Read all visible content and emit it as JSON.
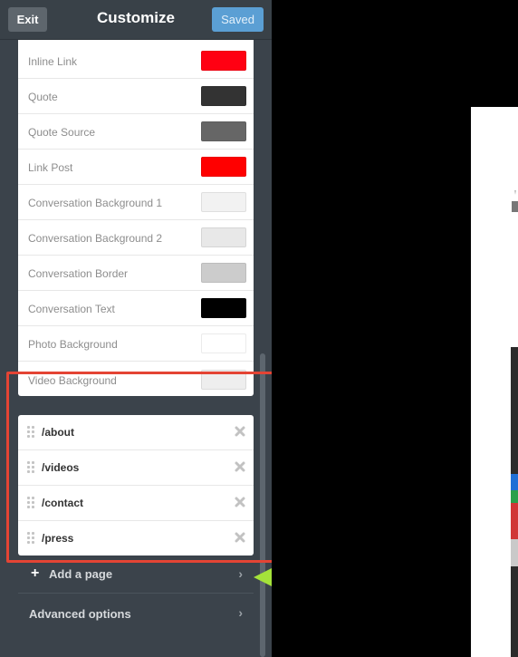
{
  "header": {
    "exit_label": "Exit",
    "title": "Customize",
    "saved_label": "Saved"
  },
  "colors": [
    {
      "label": "Inline Link",
      "value": "#ff0012"
    },
    {
      "label": "Quote",
      "value": "#333333"
    },
    {
      "label": "Quote Source",
      "value": "#666666"
    },
    {
      "label": "Link Post",
      "value": "#ff0000"
    },
    {
      "label": "Conversation Background 1",
      "value": "#f2f2f2"
    },
    {
      "label": "Conversation Background 2",
      "value": "#e8e8e8"
    },
    {
      "label": "Conversation Border",
      "value": "#cccccc"
    },
    {
      "label": "Conversation Text",
      "value": "#000000"
    },
    {
      "label": "Photo Background",
      "value": "#ffffff"
    },
    {
      "label": "Video Background",
      "value": "#eeeeee"
    }
  ],
  "pages": [
    {
      "label": "/about"
    },
    {
      "label": "/videos"
    },
    {
      "label": "/contact"
    },
    {
      "label": "/press"
    }
  ],
  "add_page": {
    "label": "Add a page",
    "icon": "plus-icon"
  },
  "advanced": {
    "label": "Advanced options",
    "icon": "chevron-right-icon"
  },
  "highlight": {
    "color": "#e44434"
  },
  "arrow": {
    "color": "#a4e23a"
  }
}
